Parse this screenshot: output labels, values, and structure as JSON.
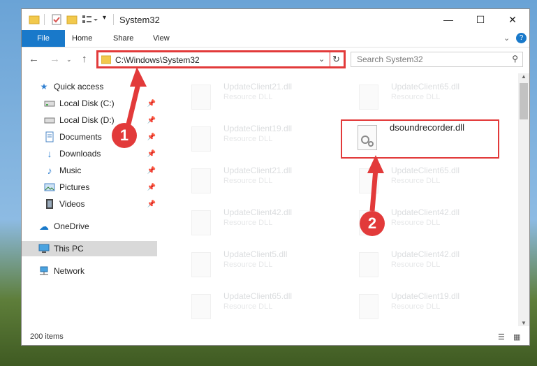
{
  "window": {
    "title": "System32"
  },
  "ribbon": {
    "tabs": [
      "File",
      "Home",
      "Share",
      "View"
    ]
  },
  "address": {
    "path": "C:\\Windows\\System32",
    "search_placeholder": "Search System32"
  },
  "sidebar": {
    "items": [
      {
        "label": "Quick access",
        "icon": "star-icon"
      },
      {
        "label": "Local Disk (C:)",
        "icon": "drive-icon"
      },
      {
        "label": "Local Disk (D:)",
        "icon": "drive-icon"
      },
      {
        "label": "Documents",
        "icon": "documents-icon"
      },
      {
        "label": "Downloads",
        "icon": "download-icon"
      },
      {
        "label": "Music",
        "icon": "music-icon"
      },
      {
        "label": "Pictures",
        "icon": "pictures-icon"
      },
      {
        "label": "Videos",
        "icon": "videos-icon"
      },
      {
        "label": "OneDrive",
        "icon": "cloud-icon"
      },
      {
        "label": "This PC",
        "icon": "pc-icon"
      },
      {
        "label": "Network",
        "icon": "network-icon"
      }
    ]
  },
  "files": {
    "left": [
      {
        "name": "UpdateClient21.dll",
        "type": "Resource DLL"
      },
      {
        "name": "UpdateClient19.dll",
        "type": "Resource DLL"
      },
      {
        "name": "UpdateClient21.dll",
        "type": "Resource DLL"
      },
      {
        "name": "UpdateClient42.dll",
        "type": "Resource DLL"
      },
      {
        "name": "UpdateClient5.dll",
        "type": "Resource DLL"
      },
      {
        "name": "UpdateClient65.dll",
        "type": "Resource DLL"
      }
    ],
    "right": [
      {
        "name": "UpdateClient65.dll",
        "type": "Resource DLL"
      },
      {
        "name": "dsoundrecorder.dll",
        "type": ""
      },
      {
        "name": "UpdateClient65.dll",
        "type": "Resource DLL"
      },
      {
        "name": "UpdateClient42.dll",
        "type": "Resource DLL"
      },
      {
        "name": "UpdateClient42.dll",
        "type": "Resource DLL"
      },
      {
        "name": "UpdateClient19.dll",
        "type": "Resource DLL"
      }
    ]
  },
  "status": {
    "items": "200 items"
  },
  "annotations": {
    "step1": "1",
    "step2": "2",
    "color": "#e23a3a"
  }
}
